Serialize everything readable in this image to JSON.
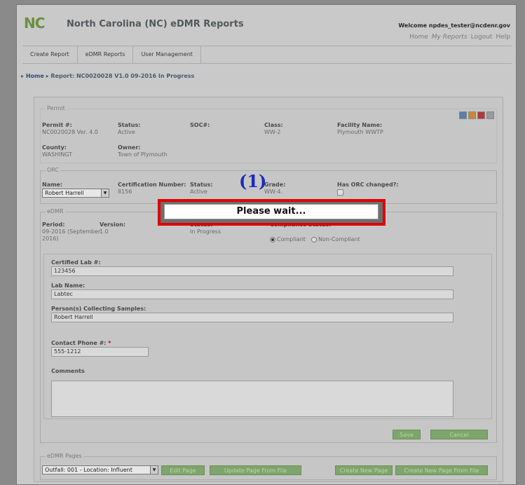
{
  "header": {
    "logo_text": "NC",
    "title": "North Carolina (NC) eDMR Reports",
    "welcome": "Welcome npdes_tester@ncdenr.gov",
    "links": [
      "Home",
      "My Reports",
      "Logout",
      "Help"
    ]
  },
  "nav": {
    "tabs": [
      "Create Report",
      "eDMR Reports",
      "User Management"
    ]
  },
  "breadcrumb": {
    "home": "Home",
    "sep": "▸",
    "current": "Report: NC0020028 V1.0 09-2016 In Progress"
  },
  "permit": {
    "legend": "Permit",
    "permit_label": "Permit #:",
    "permit_value": "NC0020028 Ver. 4.0",
    "status_label": "Status:",
    "status_value": "Active",
    "soc_label": "SOC#:",
    "class_label": "Class:",
    "class_value": "WW-2",
    "facility_label": "Facility Name:",
    "facility_value": "Plymouth WWTP",
    "county_label": "County:",
    "county_value": "WASHINGT",
    "owner_label": "Owner:",
    "owner_value": "Town of Plymouth"
  },
  "orc": {
    "legend": "ORC",
    "name_label": "Name:",
    "name_value": "Robert Harrell",
    "cert_label": "Certification Number:",
    "cert_value": "8156",
    "status_label": "Status:",
    "status_value": "Active",
    "grade_label": "Grade:",
    "grade_value": "WW-4.",
    "changed_label": "Has ORC changed?:"
  },
  "edmr": {
    "legend": "eDMR",
    "period_label": "Period:",
    "period_value_1": "09-2016 (September",
    "period_value_2": "2016)",
    "version_label": "Version:",
    "version_value": "1.0",
    "status_label": "Status:",
    "status_value": "In Progress",
    "compliance_label": "Compliance Status:",
    "compliance_req": "*",
    "compliant": "Compliant",
    "non_compliant": "Non-Compliant"
  },
  "lab": {
    "cert_lab_label": "Certified Lab #:",
    "cert_lab_value": "123456",
    "lab_name_label": "Lab Name:",
    "lab_name_value": "Labtec",
    "persons_label": "Person(s) Collecting Samples:",
    "persons_value": "Robert Harrell",
    "phone_label": "Contact Phone #:",
    "phone_req": "*",
    "phone_value": "555-1212",
    "comments_label": "Comments"
  },
  "actions": {
    "save": "Save",
    "cancel": "Cancel"
  },
  "pages": {
    "legend": "eDMR Pages",
    "outfall_value": "Outfall: 001 - Location: Influent",
    "edit_page": "Edit Page",
    "update_from_file": "Update Page From File",
    "create_new": "Create New Page",
    "create_new_from_file": "Create New Page From File"
  },
  "overlay": {
    "annotation": "(1)",
    "message": "Please wait..."
  }
}
